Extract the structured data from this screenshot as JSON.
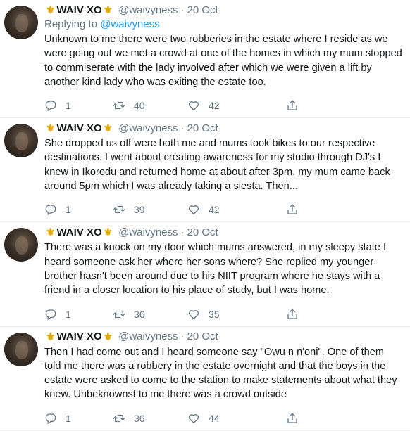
{
  "author": {
    "name": "WAIV XO",
    "badge_left": "⚜",
    "badge_right": "⚜",
    "handle": "@waivyness",
    "separator": "·"
  },
  "tweets": [
    {
      "date": "20 Oct",
      "replying_prefix": "Replying to ",
      "replying_to": "@waivyness",
      "text": "Unknown to me there were two robberies in the estate where I reside as we were going out we met a crowd at one of the homes in which my mum stopped to commiserate with the lady involved after which we were given a lift by another kind lady who was exiting the estate too.",
      "replies": "1",
      "retweets": "40",
      "likes": "42"
    },
    {
      "date": "20 Oct",
      "text": "She dropped us off were both me and mums took bikes to our respective destinations. I went about creating awareness for my studio through DJ's I knew in Ikorodu and returned home at about after 3pm, my mum came back around 5pm which I was already taking a siesta. Then...",
      "replies": "1",
      "retweets": "39",
      "likes": "42"
    },
    {
      "date": "20 Oct",
      "text": "There was a knock on my door which mums answered, in my sleepy state I heard someone ask her where her sons where? She replied my younger brother hasn't been around due to his NIIT program where he stays with a friend in a closer location to his place of study, but I was home.",
      "replies": "1",
      "retweets": "36",
      "likes": "35"
    },
    {
      "date": "20 Oct",
      "text": "Then I had come out and I heard someone say \"Owu n n'oni\". One of them told me there was a robbery in the estate overnight and that the boys in the estate were asked to come to the station to make statements about what they knew. Unbeknownst to me there was a crowd outside",
      "replies": "1",
      "retweets": "36",
      "likes": "44"
    }
  ],
  "colors": {
    "text": "#14171a",
    "secondary": "#657786",
    "link": "#1da1f2",
    "divider": "#e6ecf0",
    "badge": "#e0a800"
  },
  "icons": [
    "reply-icon",
    "retweet-icon",
    "like-icon",
    "share-icon"
  ]
}
